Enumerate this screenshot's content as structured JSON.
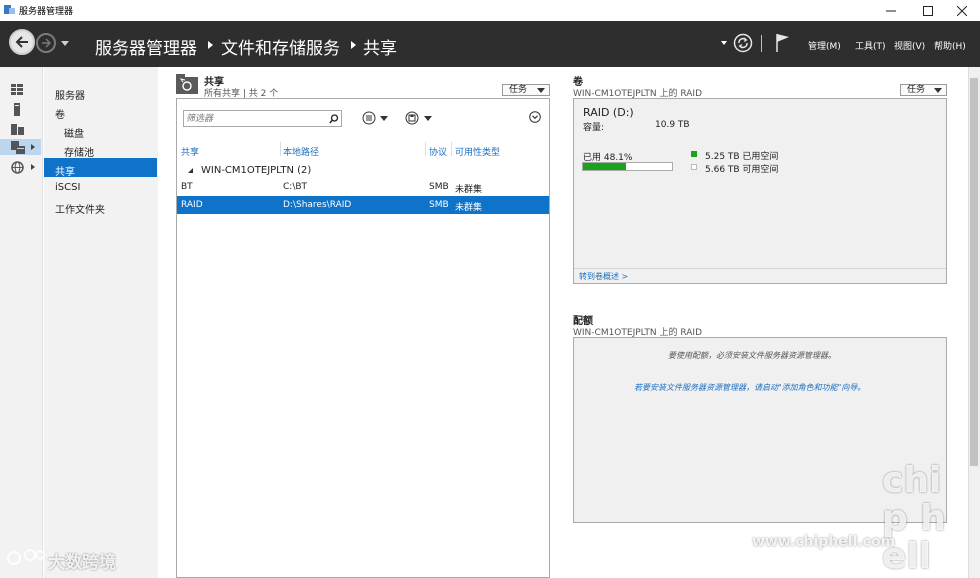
{
  "window": {
    "title": "服务器管理器"
  },
  "breadcrumb": [
    "服务器管理器",
    "文件和存储服务",
    "共享"
  ],
  "menus": [
    "管理(M)",
    "工具(T)",
    "视图(V)",
    "帮助(H)"
  ],
  "nav": {
    "items": [
      "服务器",
      "卷",
      "磁盘",
      "存储池",
      "共享",
      "iSCSI",
      "工作文件夹"
    ],
    "selected": "共享"
  },
  "shares": {
    "title": "共享",
    "subtitle": "所有共享 | 共 2 个",
    "tasks_label": "任务",
    "filter_placeholder": "筛选器",
    "columns": [
      "共享",
      "本地路径",
      "协议",
      "可用性类型"
    ],
    "group": "WIN-CM1OTEJPLTN (2)",
    "rows": [
      {
        "share": "BT",
        "path": "C:\\BT",
        "protocol": "SMB",
        "availability": "未群集",
        "selected": false
      },
      {
        "share": "RAID",
        "path": "D:\\Shares\\RAID",
        "protocol": "SMB",
        "availability": "未群集",
        "selected": true
      }
    ]
  },
  "volume": {
    "section_title": "卷",
    "subtitle": "WIN-CM1OTEJPLTN 上的 RAID",
    "tasks_label": "任务",
    "name": "RAID (D:)",
    "capacity_label": "容量:",
    "capacity_value": "10.9 TB",
    "used_label": "已用 48.1%",
    "used_fraction": 0.481,
    "used_space": "5.25 TB 已用空间",
    "free_space": "5.66 TB 可用空间",
    "goto_link": "转到卷概述 >"
  },
  "quota": {
    "section_title": "配额",
    "subtitle": "WIN-CM1OTEJPLTN 上的 RAID",
    "message": "要使用配额，必须安装文件服务器资源管理器。",
    "link": "若要安装文件服务器资源管理器，请启动\"添加角色和功能\"向导。"
  },
  "watermarks": {
    "left": "大数跨境",
    "right_url": "www.chiphell.com",
    "right_logo": "chip hell"
  },
  "colors": {
    "accent": "#0e73c9",
    "header": "#2e2e2e",
    "used_bar": "#1aa31a",
    "link": "#1e6fc0"
  }
}
